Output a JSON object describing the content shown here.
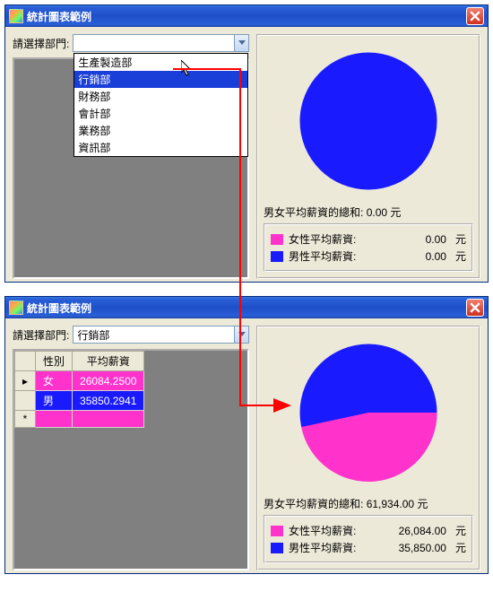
{
  "window1": {
    "title": "統計圖表範例",
    "select_label": "請選擇部門:",
    "combo_value": "",
    "dropdown_options": [
      "生產製造部",
      "行銷部",
      "財務部",
      "會計部",
      "業務部",
      "資訊部"
    ],
    "dropdown_selected_index": 1,
    "total_label": "男女平均薪資的總和:",
    "total_value": "0.00",
    "legend_female_label": "女性平均薪資:",
    "legend_female_value": "0.00",
    "legend_male_label": "男性平均薪資:",
    "legend_male_value": "0.00",
    "currency": "元"
  },
  "window2": {
    "title": "統計圖表範例",
    "select_label": "請選擇部門:",
    "combo_value": "行銷部",
    "grid_header_gender": "性別",
    "grid_header_salary": "平均薪資",
    "grid_rows": [
      {
        "gender": "女",
        "salary": "26084.2500",
        "color": "pink"
      },
      {
        "gender": "男",
        "salary": "35850.2941",
        "color": "blue"
      }
    ],
    "total_label": "男女平均薪資的總和:",
    "total_value": "61,934.00",
    "legend_female_label": "女性平均薪資:",
    "legend_female_value": "26,084.00",
    "legend_male_label": "男性平均薪資:",
    "legend_male_value": "35,850.00",
    "currency": "元"
  },
  "chart_data": [
    {
      "type": "pie",
      "series": [
        {
          "name": "男性平均薪資",
          "values": [
            1.0
          ],
          "color": "#1a1aff"
        }
      ],
      "title": "男女平均薪資的總和: 0.00 元",
      "legend": [
        "女性平均薪資 0.00",
        "男性平均薪資 0.00"
      ]
    },
    {
      "type": "pie",
      "categories": [
        "女性平均薪資",
        "男性平均薪資"
      ],
      "values": [
        26084.0,
        35850.0
      ],
      "colors": [
        "#ff33cc",
        "#1a1aff"
      ],
      "title": "男女平均薪資的總和: 61,934.00 元"
    }
  ]
}
